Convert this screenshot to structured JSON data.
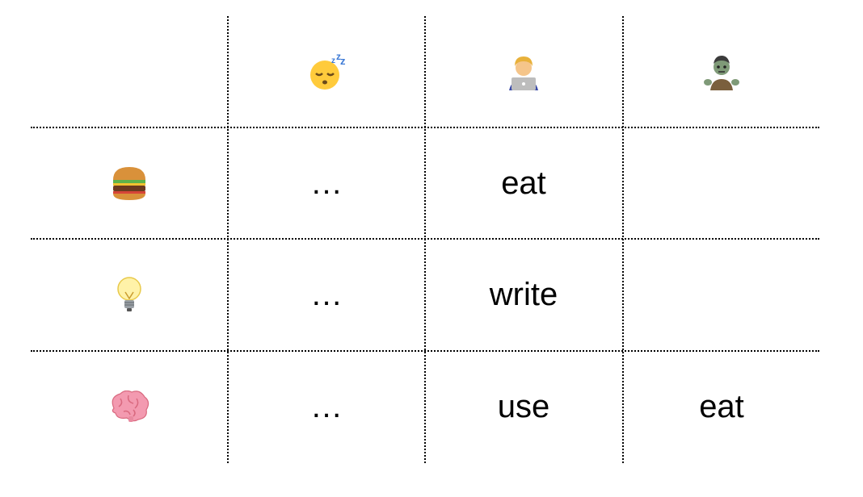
{
  "header": {
    "col1_icon": "sleeping-face-icon",
    "col2_icon": "man-technologist-icon",
    "col3_icon": "zombie-icon"
  },
  "rows": [
    {
      "icon": "hamburger-icon",
      "cells": [
        "…",
        "eat",
        ""
      ]
    },
    {
      "icon": "light-bulb-icon",
      "cells": [
        "…",
        "write",
        ""
      ]
    },
    {
      "icon": "brain-icon",
      "cells": [
        "…",
        "use",
        "eat"
      ]
    }
  ]
}
